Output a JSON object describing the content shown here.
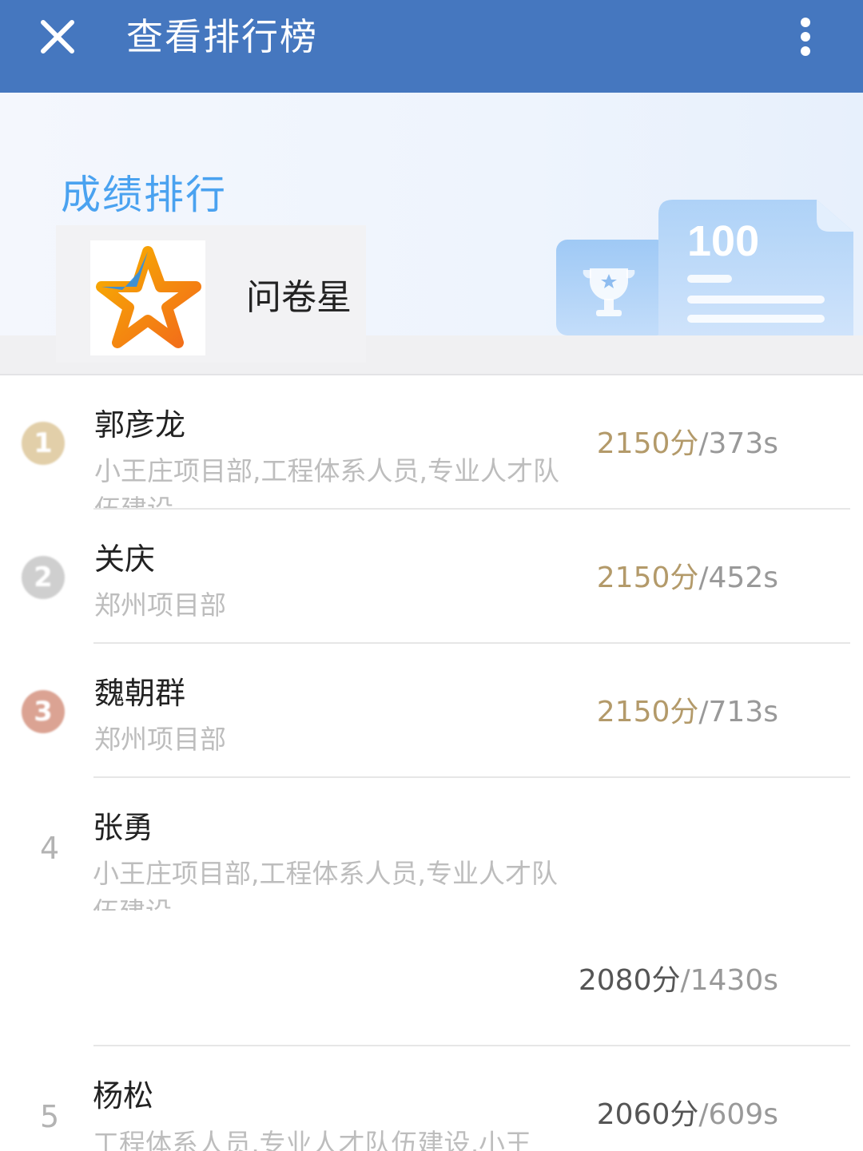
{
  "header": {
    "title": "查看排行榜"
  },
  "banner": {
    "title": "成绩排行",
    "logo_name": "问卷星",
    "illustration_text": "100"
  },
  "leaderboard": [
    {
      "rank": "1",
      "name": "郭彦龙",
      "dept": "小王庄项目部,工程体系人员,专业人才队伍建设",
      "points": "2150分",
      "time": "/373s"
    },
    {
      "rank": "2",
      "name": "关庆",
      "dept": "郑州项目部",
      "points": "2150分",
      "time": "/452s"
    },
    {
      "rank": "3",
      "name": "魏朝群",
      "dept": "郑州项目部",
      "points": "2150分",
      "time": "/713s"
    },
    {
      "rank": "4",
      "name": "张勇",
      "dept": "小王庄项目部,工程体系人员,专业人才队伍建设",
      "points": "2080分",
      "time": "/1430s"
    },
    {
      "rank": "5",
      "name": "杨松",
      "dept": "工程体系人员,专业人才队伍建设,小王",
      "points": "2060分",
      "time": "/609s"
    }
  ],
  "colors": {
    "topbar": "#4577bf",
    "gold": "#e2cfa9",
    "silver": "#cfcfcf",
    "bronze": "#dba393",
    "score_accent": "#b39a6a"
  }
}
